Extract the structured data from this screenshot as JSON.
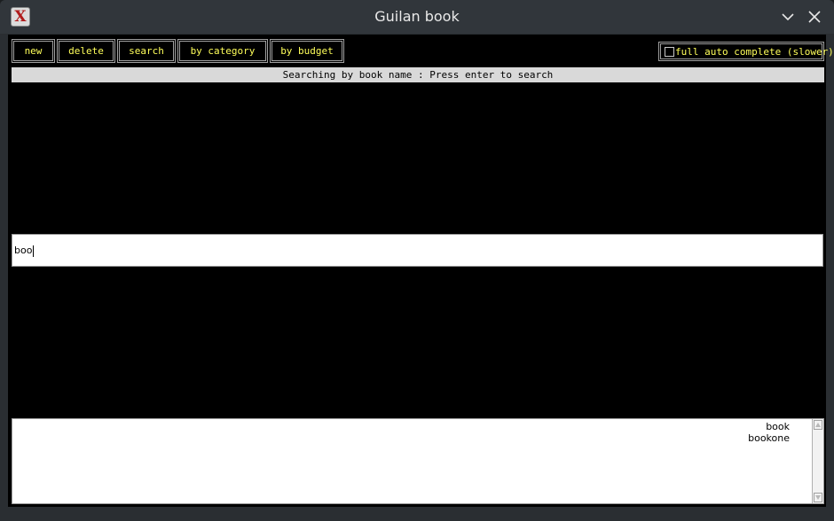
{
  "window": {
    "title": "Guilan book",
    "app_icon_glyph": "X",
    "controls": [
      "chevron-down-icon",
      "close-icon"
    ]
  },
  "toolbar": {
    "new_label": "new",
    "delete_label": "delete",
    "search_label": "search",
    "by_category_label": "by category",
    "by_budget_label": "by budget",
    "auto_complete_label": "full auto complete (slower)",
    "auto_complete_checked": false
  },
  "status": {
    "text": "Searching by book name : Press enter to search"
  },
  "search": {
    "value": "boo"
  },
  "results": {
    "items": [
      "book",
      "bookone"
    ]
  },
  "colors": {
    "button_text": "#ffff5a",
    "background": "#000000",
    "status_bar": "#d9d9d9"
  }
}
